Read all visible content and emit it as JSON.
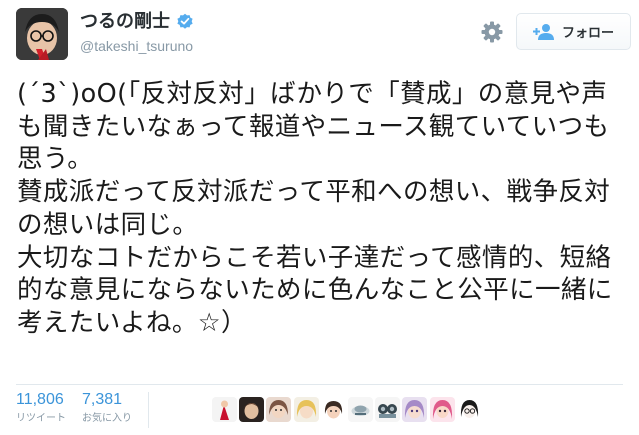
{
  "user": {
    "display_name": "つるの剛士",
    "handle": "@takeshi_tsuruno",
    "verified_icon": "verified-badge-icon"
  },
  "actions": {
    "follow_label": "フォロー",
    "follow_icon": "add-user-icon",
    "settings_icon": "gear-icon"
  },
  "tweet": {
    "text": "(´3`)oO(「反対反対」ばかりで「賛成」の意見や声も聞きたいなぁって報道やニュース観ていていつも思う。\n賛成派だって反対派だって平和への想い、戦争反対の想いは同じ。\n大切なコトだからこそ若い子達だって感情的、短絡的な意見にならないために色んなこと公平に一緒に考えたいよね。☆）"
  },
  "stats": [
    {
      "count": "11,806",
      "label": "リツイート"
    },
    {
      "count": "7,381",
      "label": "お気に入り"
    }
  ],
  "colors": {
    "link_blue": "#3b94d9",
    "verified_blue": "#55acee",
    "muted_gray": "#8899a6",
    "border": "#e1e8ed"
  }
}
